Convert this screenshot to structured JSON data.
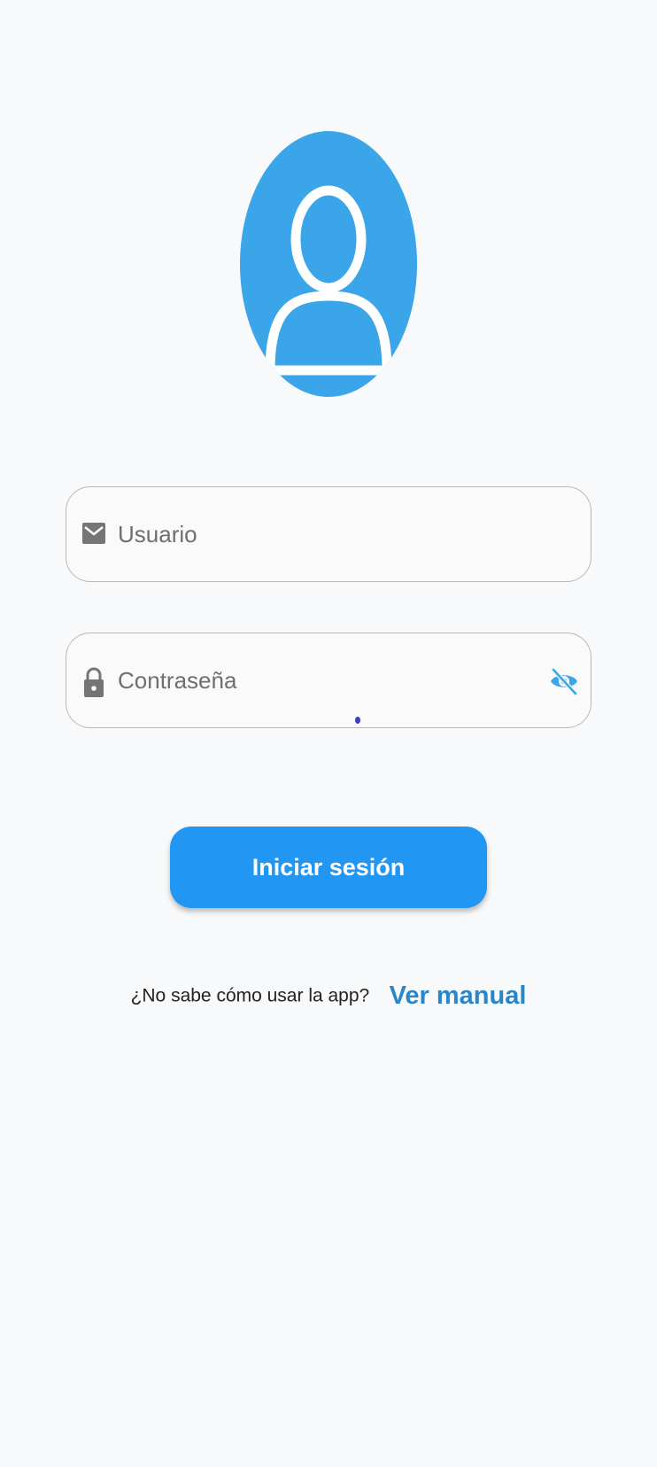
{
  "avatar": {
    "icon": "user-avatar-icon",
    "color": "#3aa5e8"
  },
  "username": {
    "icon": "mail-icon",
    "placeholder": "Usuario",
    "value": ""
  },
  "password": {
    "icon": "lock-icon",
    "placeholder": "Contraseña",
    "value": "",
    "toggle_icon": "eye-off-icon"
  },
  "login_button": {
    "label": "Iniciar sesión",
    "color": "#2196f3"
  },
  "help": {
    "question": "¿No sabe cómo usar la app?",
    "link_label": "Ver manual",
    "link_color": "#2a86c8"
  }
}
